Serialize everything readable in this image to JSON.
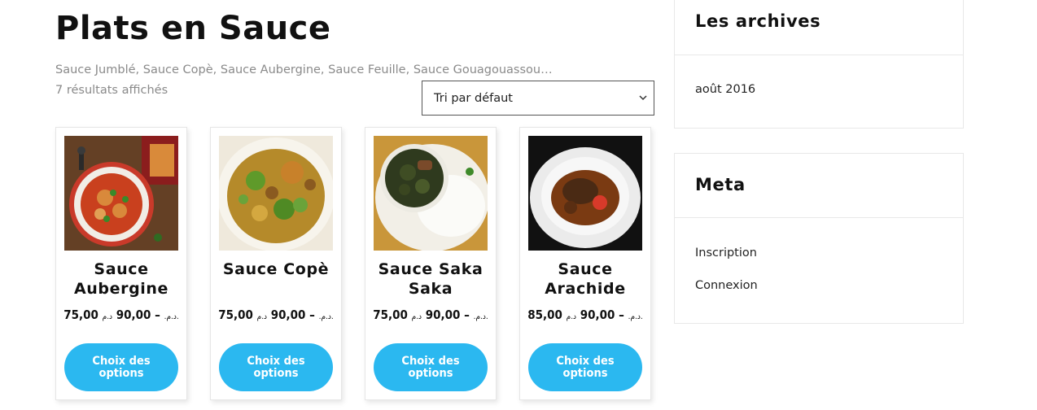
{
  "category": {
    "title": "Plats en Sauce",
    "description": "Sauce Jumblé, Sauce Copè, Sauce Aubergine, Sauce Feuille, Sauce Gouagouassou…",
    "result_count": "7 résultats affichés"
  },
  "sort": {
    "selected": "Tri par défaut"
  },
  "products": [
    {
      "name": "Sauce Aubergine",
      "price_min": "75,00",
      "price_max": "90,00",
      "currency": "د.م.",
      "dash": "–",
      "button_label": "Choix des options",
      "image_icon": "sauce-aubergine-photo"
    },
    {
      "name": "Sauce Copè",
      "price_min": "75,00",
      "price_max": "90,00",
      "currency": "د.م.",
      "dash": "–",
      "button_label": "Choix des options",
      "image_icon": "sauce-cope-photo"
    },
    {
      "name": "Sauce Saka Saka",
      "price_min": "75,00",
      "price_max": "90,00",
      "currency": "د.م.",
      "dash": "–",
      "button_label": "Choix des options",
      "image_icon": "sauce-saka-saka-photo"
    },
    {
      "name": "Sauce Arachide",
      "price_min": "85,00",
      "price_max": "90,00",
      "currency": "د.م.",
      "dash": "–",
      "button_label": "Choix des options",
      "image_icon": "sauce-arachide-photo"
    }
  ],
  "sidebar": {
    "archives": {
      "title": "Les archives",
      "items": [
        "août 2016"
      ]
    },
    "meta": {
      "title": "Meta",
      "items": [
        "Inscription",
        "Connexion"
      ]
    }
  },
  "colors": {
    "button": "#2bb8f0",
    "text": "#111111",
    "muted": "#8a8a8a"
  }
}
